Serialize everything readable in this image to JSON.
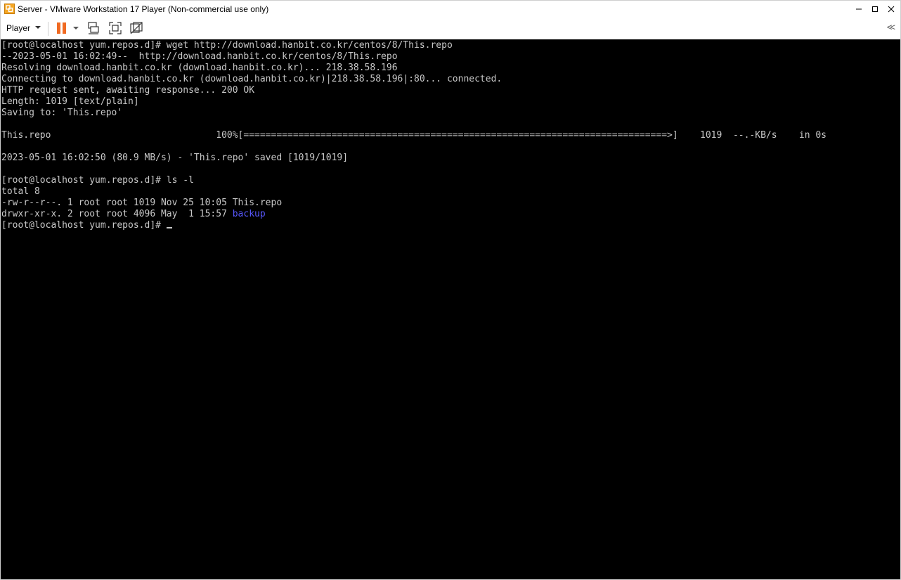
{
  "window": {
    "title": "Server - VMware Workstation 17 Player (Non-commercial use only)"
  },
  "toolbar": {
    "player_label": "Player",
    "icons": [
      "pause-icon",
      "send-ctrl-alt-del-icon",
      "fullscreen-icon",
      "unity-icon",
      "collapse-icon"
    ],
    "accent_color": "#f06a22",
    "collapse_glyph": "<<"
  },
  "terminal": {
    "background": "#000000",
    "text_color": "#c8c8c8",
    "dir_color": "#5858ff",
    "lines": [
      "[root@localhost yum.repos.d]# wget http://download.hanbit.co.kr/centos/8/This.repo",
      "--2023-05-01 16:02:49--  http://download.hanbit.co.kr/centos/8/This.repo",
      "Resolving download.hanbit.co.kr (download.hanbit.co.kr)... 218.38.58.196",
      "Connecting to download.hanbit.co.kr (download.hanbit.co.kr)|218.38.58.196|:80... connected.",
      "HTTP request sent, awaiting response... 200 OK",
      "Length: 1019 [text/plain]",
      "Saving to: 'This.repo'",
      "",
      "This.repo                              100%[=============================================================================>]    1019  --.-KB/s    in 0s",
      "",
      "2023-05-01 16:02:50 (80.9 MB/s) - 'This.repo' saved [1019/1019]",
      "",
      "[root@localhost yum.repos.d]# ls -l",
      "total 8",
      "-rw-r--r--. 1 root root 1019 Nov 25 10:05 This.repo"
    ],
    "dir_line_prefix": "drwxr-xr-x. 2 root root 4096 May  1 15:57 ",
    "dir_name": "backup",
    "prompt": "[root@localhost yum.repos.d]# "
  }
}
